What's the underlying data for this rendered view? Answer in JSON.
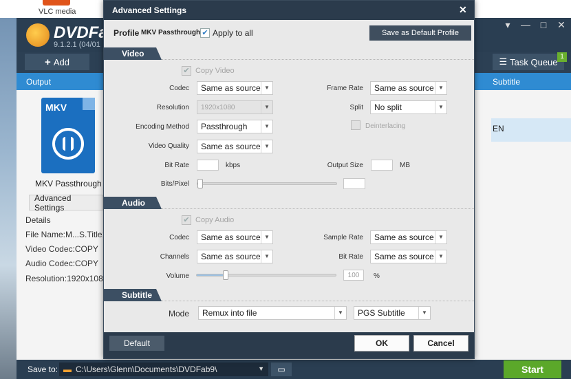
{
  "desktop": {
    "icon_label": "VLC media"
  },
  "app": {
    "logo": "DVDFab",
    "version": "9.1.2.1 (04/01",
    "add_label": "Add",
    "task_queue_label": "Task Queue",
    "task_queue_count": "1",
    "columns": {
      "output": "Output",
      "subtitle": "Subtitle"
    },
    "subtitle_value": "EN",
    "profile_icon_label": "MKV",
    "profile_name": "MKV Passthrough",
    "advanced_settings_label": "Advanced Settings",
    "details": [
      "Details",
      "File Name:M...S.Title1",
      "Video Codec:COPY",
      "Audio Codec:COPY",
      "Resolution:1920x1080"
    ],
    "save_to_label": "Save to:",
    "save_to_path": "C:\\Users\\Glenn\\Documents\\DVDFab9\\",
    "start_label": "Start",
    "window_controls": [
      "▾",
      "—",
      "□",
      "✕"
    ]
  },
  "dialog": {
    "title": "Advanced Settings",
    "close": "✕",
    "profile_label": "Profile",
    "profile_value": "MKV Passthrough",
    "apply_to_all": "Apply to all",
    "apply_to_all_checked": true,
    "save_default_label": "Save as Default Profile",
    "video": {
      "section": "Video",
      "copy_video": "Copy Video",
      "codec_label": "Codec",
      "codec_value": "Same as source",
      "frame_rate_label": "Frame Rate",
      "frame_rate_value": "Same as source",
      "resolution_label": "Resolution",
      "resolution_value": "1920x1080",
      "split_label": "Split",
      "split_value": "No split",
      "encoding_label": "Encoding Method",
      "encoding_value": "Passthrough",
      "deinterlacing_label": "Deinterlacing",
      "quality_label": "Video Quality",
      "quality_value": "Same as source",
      "bitrate_label": "Bit Rate",
      "bitrate_unit": "kbps",
      "output_size_label": "Output Size",
      "output_size_unit": "MB",
      "bits_pixel_label": "Bits/Pixel"
    },
    "audio": {
      "section": "Audio",
      "copy_audio": "Copy Audio",
      "codec_label": "Codec",
      "codec_value": "Same as source",
      "sample_rate_label": "Sample Rate",
      "sample_rate_value": "Same as source",
      "channels_label": "Channels",
      "channels_value": "Same as source",
      "bitrate_label": "Bit Rate",
      "bitrate_value": "Same as source",
      "volume_label": "Volume",
      "volume_value": "100",
      "volume_unit": "%",
      "volume_level": 0.21
    },
    "subtitle": {
      "section": "Subtitle",
      "mode_label": "Mode",
      "mode_value": "Remux into file",
      "format_value": "PGS Subtitle"
    },
    "default_label": "Default",
    "ok_label": "OK",
    "cancel_label": "Cancel"
  },
  "colors": {
    "accent": "#2f8bd2",
    "start": "#5ba82a",
    "dark": "#2b3b4c"
  }
}
